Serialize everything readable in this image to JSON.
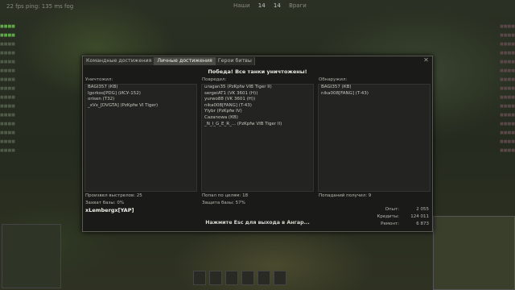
{
  "hud": {
    "top_left": "22 fps    ping: 135 ms    fog",
    "ally_label": "Наши",
    "ally_score": "14",
    "enemy_score": "14",
    "enemy_label": "Враги"
  },
  "window": {
    "tabs": [
      {
        "label": "Командные достижения"
      },
      {
        "label": "Личные достижения"
      },
      {
        "label": "Герои битвы"
      }
    ],
    "close_glyph": "✕",
    "headline": "Победа! Все танки уничтожены!",
    "columns": [
      {
        "label": "Уничтожил:",
        "items": [
          "BAGI357 (КВ)",
          "Igorkos[PDG] (ИСУ-152)",
          "orisen (T32)",
          "_xVx_[DVGTA] (PzKpfw VI Tiger)"
        ]
      },
      {
        "label": "Повредил:",
        "items": [
          "uragan35 (PzKpfw VIB Tiger II)",
          "sergeiAT1 (VK 3601 (H))",
          "yurwo88 (VK 3601 (H))",
          "nika008[FANG] (T-43)",
          "Ylybr (PzKpfw IV)",
          "Cazanowa (КВ)",
          "_N_I_G_E_R_... (PzKpfw VIB Tiger II)"
        ]
      },
      {
        "label": "Обнаружил:",
        "items": [
          "BAGI357 (КВ)",
          "nika008[FANG] (T-43)"
        ]
      }
    ],
    "stats": {
      "shots": "Произвел выстрелов: 25",
      "capture": "Захват базы: 0%",
      "hits": "Попал по целям: 18",
      "defense": "Защита базы: 57%",
      "hits_received": "Попаданий получил: 9"
    },
    "player_name": "xLembergx[YAP]",
    "rewards": [
      {
        "label": "Опыт:",
        "value": "2 055"
      },
      {
        "label": "Кредиты:",
        "value": "124 011"
      },
      {
        "label": "Ремонт:",
        "value": "6 873"
      }
    ],
    "esc_hint": "Нажмите Esc для выхода в Ангар..."
  }
}
